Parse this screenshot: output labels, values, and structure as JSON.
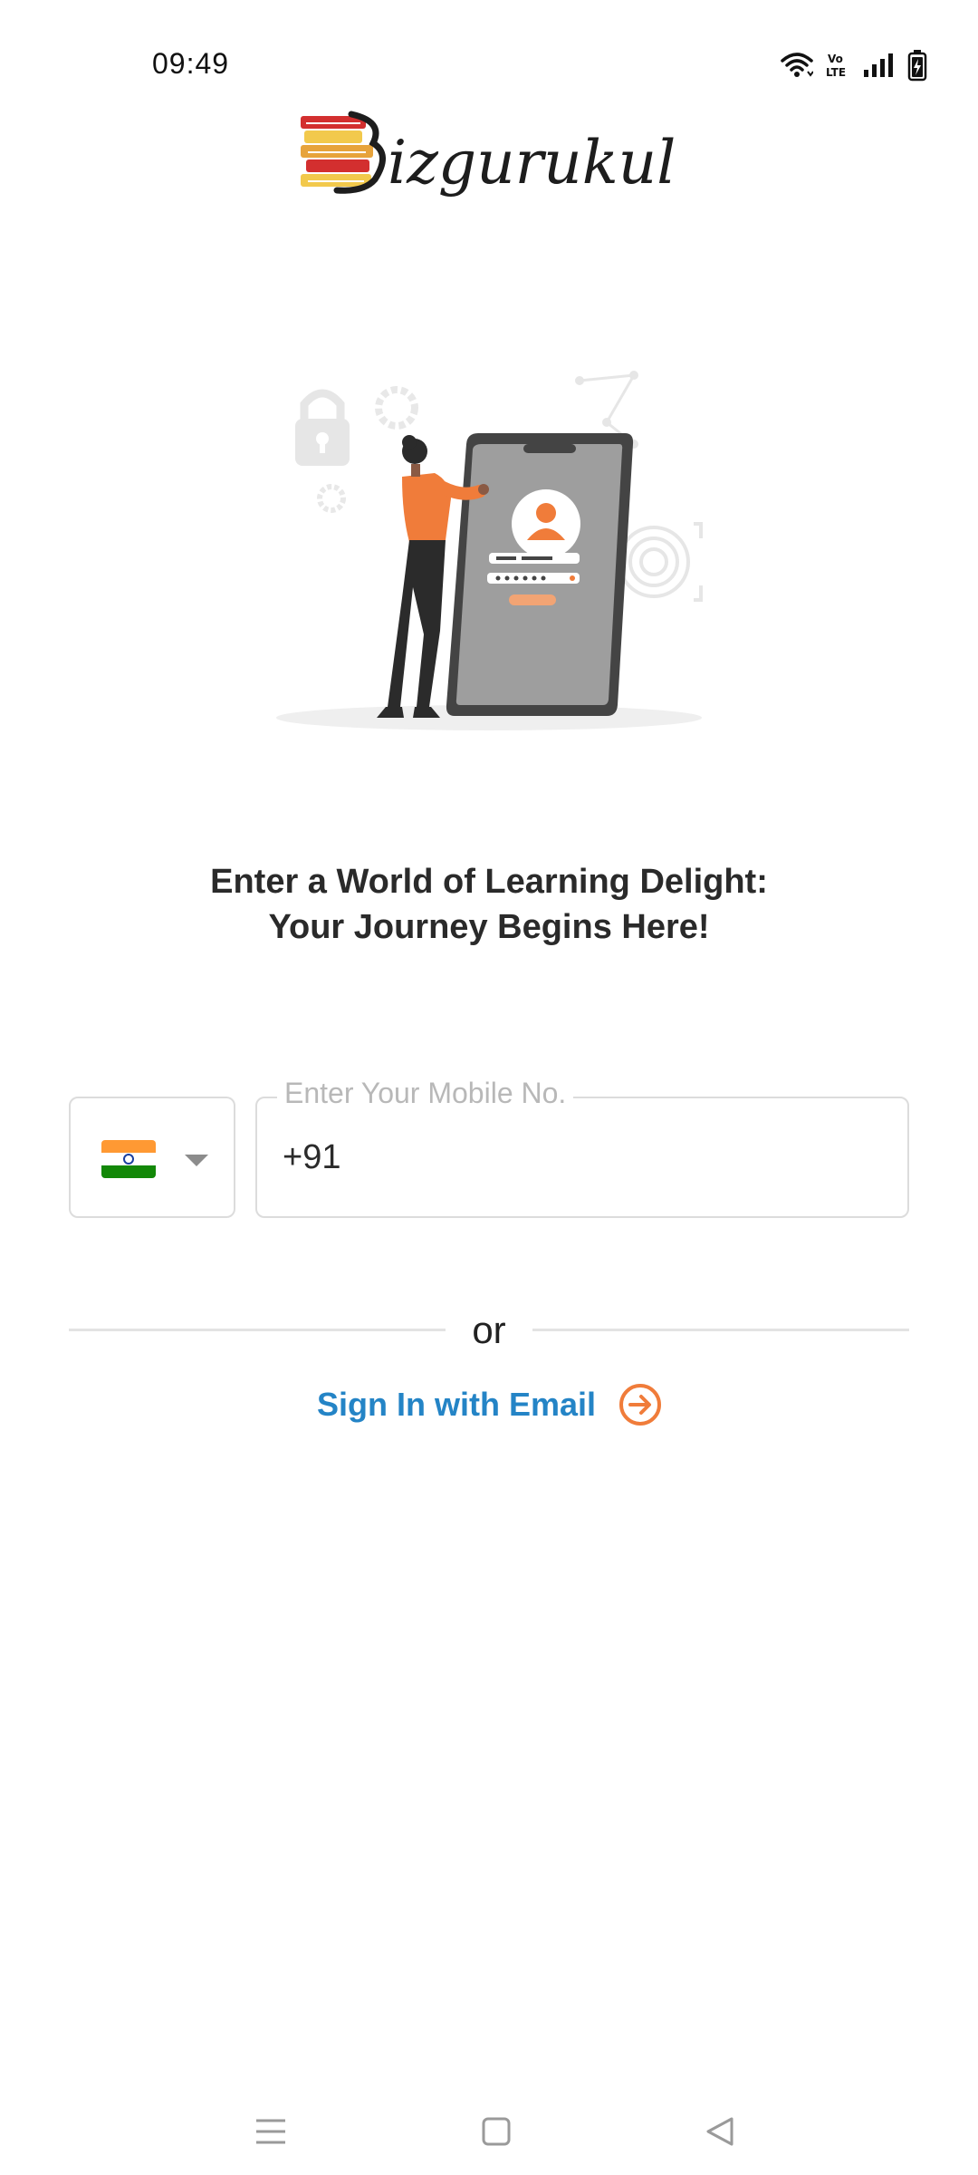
{
  "status_bar": {
    "time": "09:49",
    "icons": [
      "wifi-icon",
      "volte-icon",
      "signal-icon",
      "battery-charging-icon"
    ],
    "volte_label": "Vo LTE"
  },
  "app": {
    "logo_text": "Bizgurukul",
    "accent_color": "#f07c3a",
    "link_color": "#2484c6"
  },
  "illustration": {
    "name": "person-unlocking-phone-illustration"
  },
  "headline": {
    "line1": "Enter a World of Learning Delight:",
    "line2": "Your Journey Begins Here!"
  },
  "country_selector": {
    "flag": "india-flag-icon",
    "icon": "chevron-down-icon"
  },
  "phone_input": {
    "label": "Enter Your Mobile No.",
    "value": "+91"
  },
  "divider": {
    "text": "or"
  },
  "email_signin": {
    "label": "Sign In with Email",
    "icon": "arrow-right-circle-icon"
  },
  "nav_bar": {
    "buttons": [
      "menu-icon",
      "home-icon",
      "back-icon"
    ]
  }
}
